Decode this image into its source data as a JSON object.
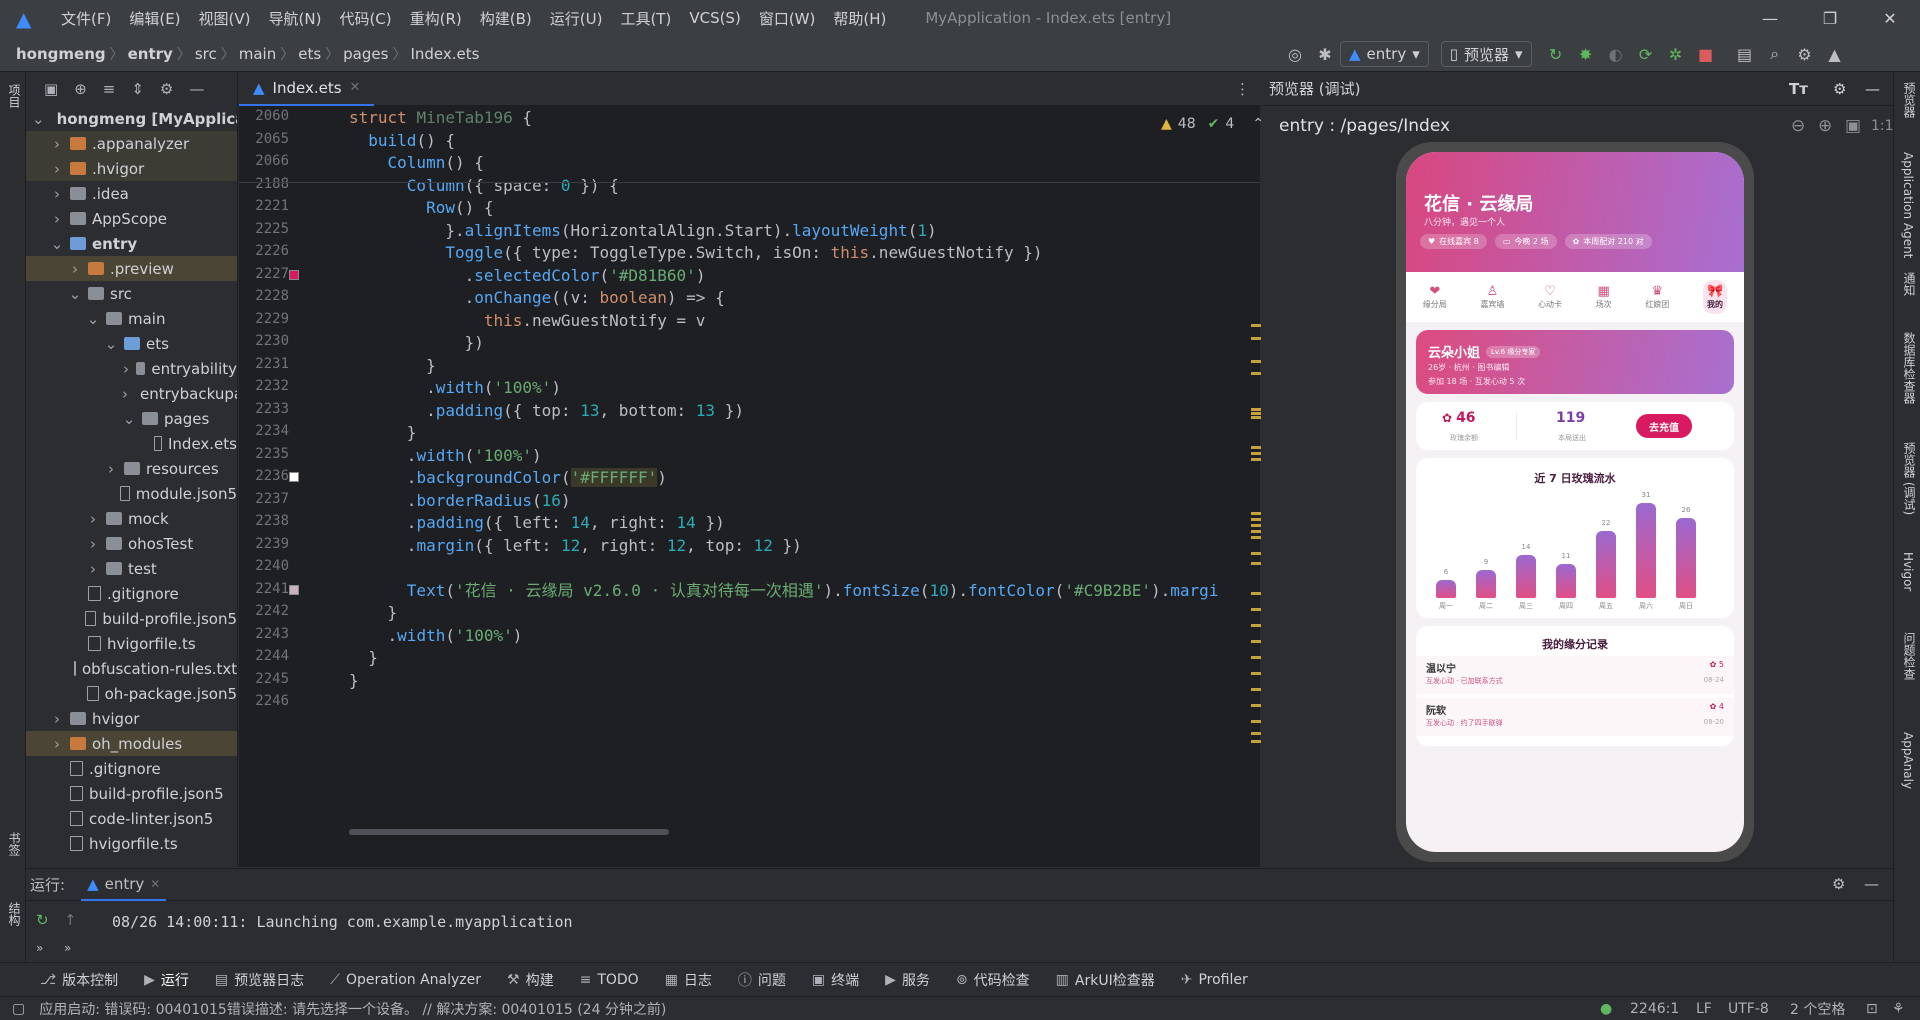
{
  "titlebar": {
    "menus": [
      "文件(F)",
      "编辑(E)",
      "视图(V)",
      "导航(N)",
      "代码(C)",
      "重构(R)",
      "构建(B)",
      "运行(U)",
      "工具(T)",
      "VCS(S)",
      "窗口(W)",
      "帮助(H)"
    ],
    "title": "MyApplication - Index.ets [entry]"
  },
  "navbar": {
    "crumbs": [
      "hongmeng",
      "entry",
      "src",
      "main",
      "ets",
      "pages",
      "Index.ets"
    ],
    "run_config": "entry",
    "device": "预览器"
  },
  "left_strip": {
    "top": "项目",
    "bottom1": "书签",
    "bottom2": "结构"
  },
  "project": {
    "rows": [
      {
        "label": "hongmeng [MyApplication]",
        "indent": 0,
        "arrow": "v",
        "kind": "folder-gray"
      },
      {
        "label": ".appanalyzer",
        "indent": 1,
        "arrow": ">",
        "kind": "folder-orange"
      },
      {
        "label": ".hvigor",
        "indent": 1,
        "arrow": ">",
        "kind": "folder-orange"
      },
      {
        "label": ".idea",
        "indent": 1,
        "arrow": ">",
        "kind": "folder-gray"
      },
      {
        "label": "AppScope",
        "indent": 1,
        "arrow": ">",
        "kind": "folder-gray"
      },
      {
        "label": "entry",
        "indent": 1,
        "arrow": "v",
        "kind": "folder-blue"
      },
      {
        "label": ".preview",
        "indent": 2,
        "arrow": ">",
        "kind": "folder-orange"
      },
      {
        "label": "src",
        "indent": 2,
        "arrow": "v",
        "kind": "folder-gray"
      },
      {
        "label": "main",
        "indent": 3,
        "arrow": "v",
        "kind": "folder-gray"
      },
      {
        "label": "ets",
        "indent": 4,
        "arrow": "v",
        "kind": "folder-blue"
      },
      {
        "label": "entryability",
        "indent": 5,
        "arrow": ">",
        "kind": "folder-gray"
      },
      {
        "label": "entrybackupability",
        "indent": 5,
        "arrow": ">",
        "kind": "folder-gray"
      },
      {
        "label": "pages",
        "indent": 5,
        "arrow": "v",
        "kind": "folder-gray"
      },
      {
        "label": "Index.ets",
        "indent": 6,
        "arrow": "",
        "kind": "file"
      },
      {
        "label": "resources",
        "indent": 4,
        "arrow": ">",
        "kind": "folder-gray"
      },
      {
        "label": "module.json5",
        "indent": 4,
        "arrow": "",
        "kind": "file"
      },
      {
        "label": "mock",
        "indent": 3,
        "arrow": ">",
        "kind": "folder-gray"
      },
      {
        "label": "ohosTest",
        "indent": 3,
        "arrow": ">",
        "kind": "folder-gray"
      },
      {
        "label": "test",
        "indent": 3,
        "arrow": ">",
        "kind": "folder-gray"
      },
      {
        "label": ".gitignore",
        "indent": 2,
        "arrow": "",
        "kind": "file"
      },
      {
        "label": "build-profile.json5",
        "indent": 2,
        "arrow": "",
        "kind": "file"
      },
      {
        "label": "hvigorfile.ts",
        "indent": 2,
        "arrow": "",
        "kind": "file"
      },
      {
        "label": "obfuscation-rules.txt",
        "indent": 2,
        "arrow": "",
        "kind": "file"
      },
      {
        "label": "oh-package.json5",
        "indent": 2,
        "arrow": "",
        "kind": "file"
      },
      {
        "label": "hvigor",
        "indent": 1,
        "arrow": ">",
        "kind": "folder-gray"
      },
      {
        "label": "oh_modules",
        "indent": 1,
        "arrow": ">",
        "kind": "folder-orange"
      },
      {
        "label": ".gitignore",
        "indent": 1,
        "arrow": "",
        "kind": "file"
      },
      {
        "label": "build-profile.json5",
        "indent": 1,
        "arrow": "",
        "kind": "file"
      },
      {
        "label": "code-linter.json5",
        "indent": 1,
        "arrow": "",
        "kind": "file"
      },
      {
        "label": "hvigorfile.ts",
        "indent": 1,
        "arrow": "",
        "kind": "file"
      }
    ]
  },
  "editor": {
    "tab": "Index.ets",
    "warnings": "48",
    "checks": "4",
    "lines": [
      {
        "n": "2060",
        "html": "<span class='kw'>struct</span> <span class='typ' style='color:#5f826b'>MineTab196</span> {"
      },
      {
        "n": "2065",
        "html": "  <span class='fn'>build</span>() {"
      },
      {
        "n": "2066",
        "html": "    <span class='fn'>Column</span>() {"
      },
      {
        "n": "2188",
        "html": "      <span class='fn'>Column</span>({ space: <span class='num'>0</span> }) {"
      },
      {
        "n": "2221",
        "html": "        <span class='fn'>Row</span>() {"
      },
      {
        "n": "2225",
        "html": "          }.<span class='fn'>alignItems</span>(HorizontalAlign.Start).<span class='fn'>layoutWeight</span>(<span class='num'>1</span>)"
      },
      {
        "n": "2226",
        "html": "          <span class='fn'>Toggle</span>({ type: ToggleType.Switch, isOn: <span class='kw'>this</span>.newGuestNotify })"
      },
      {
        "n": "2227",
        "html": "            .<span class='fn'>selectedColor</span>(<span class='str'>'#D81B60'</span>)"
      },
      {
        "n": "2228",
        "html": "            .<span class='fn'>onChange</span>((v: <span class='kw'>boolean</span>) => {"
      },
      {
        "n": "2229",
        "html": "              <span class='kw'>this</span>.newGuestNotify = v"
      },
      {
        "n": "2230",
        "html": "            })"
      },
      {
        "n": "2231",
        "html": "        }"
      },
      {
        "n": "2232",
        "html": "        .<span class='fn'>width</span>(<span class='str'>'100%'</span>)"
      },
      {
        "n": "2233",
        "html": "        .<span class='fn'>padding</span>({ top: <span class='num'>13</span>, bottom: <span class='num'>13</span> })"
      },
      {
        "n": "2234",
        "html": "      }"
      },
      {
        "n": "2235",
        "html": "      .<span class='fn'>width</span>(<span class='str'>'100%'</span>)"
      },
      {
        "n": "2236",
        "html": "      .<span class='fn'>backgroundColor</span>(<span class='str' style='background:#3b3a2a'>'#FFFFFF'</span>)"
      },
      {
        "n": "2237",
        "html": "      .<span class='fn'>borderRadius</span>(<span class='num'>16</span>)"
      },
      {
        "n": "2238",
        "html": "      .<span class='fn'>padding</span>({ left: <span class='num'>14</span>, right: <span class='num'>14</span> })"
      },
      {
        "n": "2239",
        "html": "      .<span class='fn'>margin</span>({ left: <span class='num'>12</span>, right: <span class='num'>12</span>, top: <span class='num'>12</span> })"
      },
      {
        "n": "2240",
        "html": ""
      },
      {
        "n": "2241",
        "html": "      <span class='fn'>Text</span>(<span class='str'>'花信 · 云缘局 v2.6.0 · 认真对待每一次相遇'</span>).<span class='fn'>fontSize</span>(<span class='num'>10</span>).<span class='fn'>fontColor</span>(<span class='str'>'#C9B2BE'</span>).<span class='fn'>margi</span>"
      },
      {
        "n": "2242",
        "html": "    }"
      },
      {
        "n": "2243",
        "html": "    .<span class='fn'>width</span>(<span class='str'>'100%'</span>)"
      },
      {
        "n": "2244",
        "html": "  }"
      },
      {
        "n": "2245",
        "html": "}"
      },
      {
        "n": "2246",
        "html": ""
      }
    ]
  },
  "preview": {
    "header": "预览器 (调试)",
    "route": "entry : /pages/Index",
    "app": {
      "title": "花信 · 云缘局",
      "subtitle": "八分钟，遇见一个人",
      "pills": [
        "在线嘉宾 8",
        "今晚 2 场",
        "本周配对 210 对"
      ],
      "tabs": [
        "缘分局",
        "嘉宾墙",
        "心动卡",
        "场次",
        "红娘团",
        "我的"
      ],
      "profile_name": "云朵小姐",
      "profile_badge": "Lv.6 缘分专家",
      "profile_line1": "26岁 · 杭州 · 图书编辑",
      "profile_line2": "参加 18 场 · 互发心动 5 次",
      "rose_count": "46",
      "rose_label": "玫瑰余额",
      "matches": "119",
      "matches_label": "本局送出",
      "recharge": "去充值",
      "chart_title": "近 7 日玫瑰流水",
      "records_title": "我的缘分记录",
      "records": [
        {
          "name": "温以宁",
          "desc": "互发心动 · 已加联系方式",
          "count": "5",
          "date": "08-24"
        },
        {
          "name": "阮软",
          "desc": "互发心动 · 约了四手联弹",
          "count": "4",
          "date": "08-20"
        }
      ]
    }
  },
  "chart_data": {
    "type": "bar",
    "title": "近 7 日玫瑰流水",
    "categories": [
      "周一",
      "周二",
      "周三",
      "周四",
      "周五",
      "周六",
      "周日"
    ],
    "values": [
      6,
      9,
      14,
      11,
      22,
      31,
      26
    ],
    "ylim": [
      0,
      31
    ]
  },
  "run": {
    "label": "运行:",
    "tab": "entry",
    "log": "08/26 14:00:11: Launching com.example.myapplication"
  },
  "bottombar": [
    "版本控制",
    "运行",
    "预览器日志",
    "Operation Analyzer",
    "构建",
    "TODO",
    "日志",
    "问题",
    "终端",
    "服务",
    "代码检查",
    "ArkUI检查器",
    "Profiler"
  ],
  "status": {
    "message": "应用启动: 错误码: 00401015错误描述: 请先选择一个设备。 // 解决方案: 00401015 (24 分钟之前)",
    "position": "2246:1",
    "lf": "LF",
    "encoding": "UTF-8",
    "indent": "2 个空格"
  },
  "right_strip": [
    "预览器",
    "Application Agent",
    "通知",
    "数据库检查器",
    "预览器 (调试)",
    "Hvigor",
    "问题检查",
    "AppAnaly"
  ],
  "colors": {
    "accent": "#d81b60",
    "bg": "#2b2d30",
    "editor_bg": "#1e1f22"
  }
}
